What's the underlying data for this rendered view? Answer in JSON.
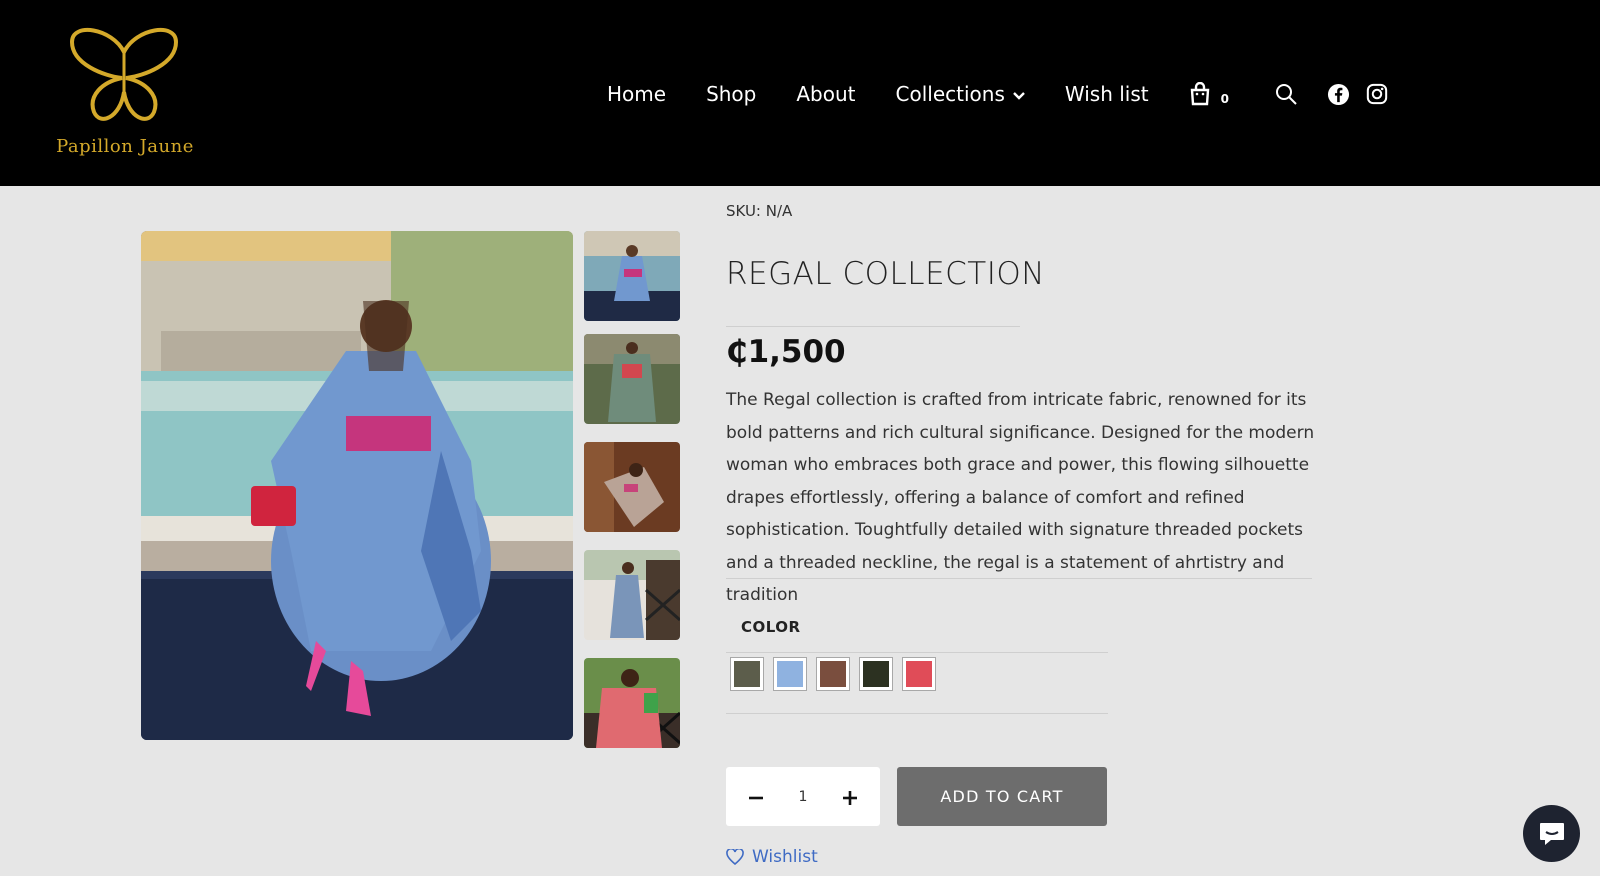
{
  "brand": {
    "name": "Papillon Jaune"
  },
  "nav": {
    "home": "Home",
    "shop": "Shop",
    "about": "About",
    "collections": "Collections",
    "wishlist": "Wish list",
    "cart_count": "0"
  },
  "icons": [
    "butterfly-logo-icon",
    "chevron-down-icon",
    "shopping-bag-icon",
    "search-icon",
    "facebook-icon",
    "instagram-icon",
    "minus-icon",
    "plus-icon",
    "heart-icon",
    "chat-icon"
  ],
  "gallery": {
    "main_alt": "Woman in blue patterned kaftan with pink waistband sitting by a pool",
    "thumbnail_count": 5
  },
  "product": {
    "sku": "SKU: N/A",
    "title": "REGAL COLLECTION",
    "price": "₵1,500",
    "description": "The Regal collection  is crafted from intricate  fabric, renowned for its bold patterns and rich cultural significance. Designed for the modern woman who embraces both grace and power, this flowing silhouette drapes effortlessly, offering a balance of comfort and refined sophistication. Toughtfully detailed with signature threaded pockets and a threaded neckline, the regal is a statement of ahrtistry and tradition",
    "color_label": "COLOR",
    "swatches": [
      "#5c5d4b",
      "#8fb2e0",
      "#7a4e3e",
      "#2c3121",
      "#e04c58"
    ],
    "quantity": "1",
    "add_to_cart": "ADD TO CART",
    "wishlist_label": "Wishlist"
  },
  "colors": {
    "header_bg": "#000000",
    "brand_gold": "#d4a92a",
    "page_bg": "#e6e6e6",
    "add_cart_bg": "#6d6d6d",
    "link_blue": "#3f6bc4"
  }
}
